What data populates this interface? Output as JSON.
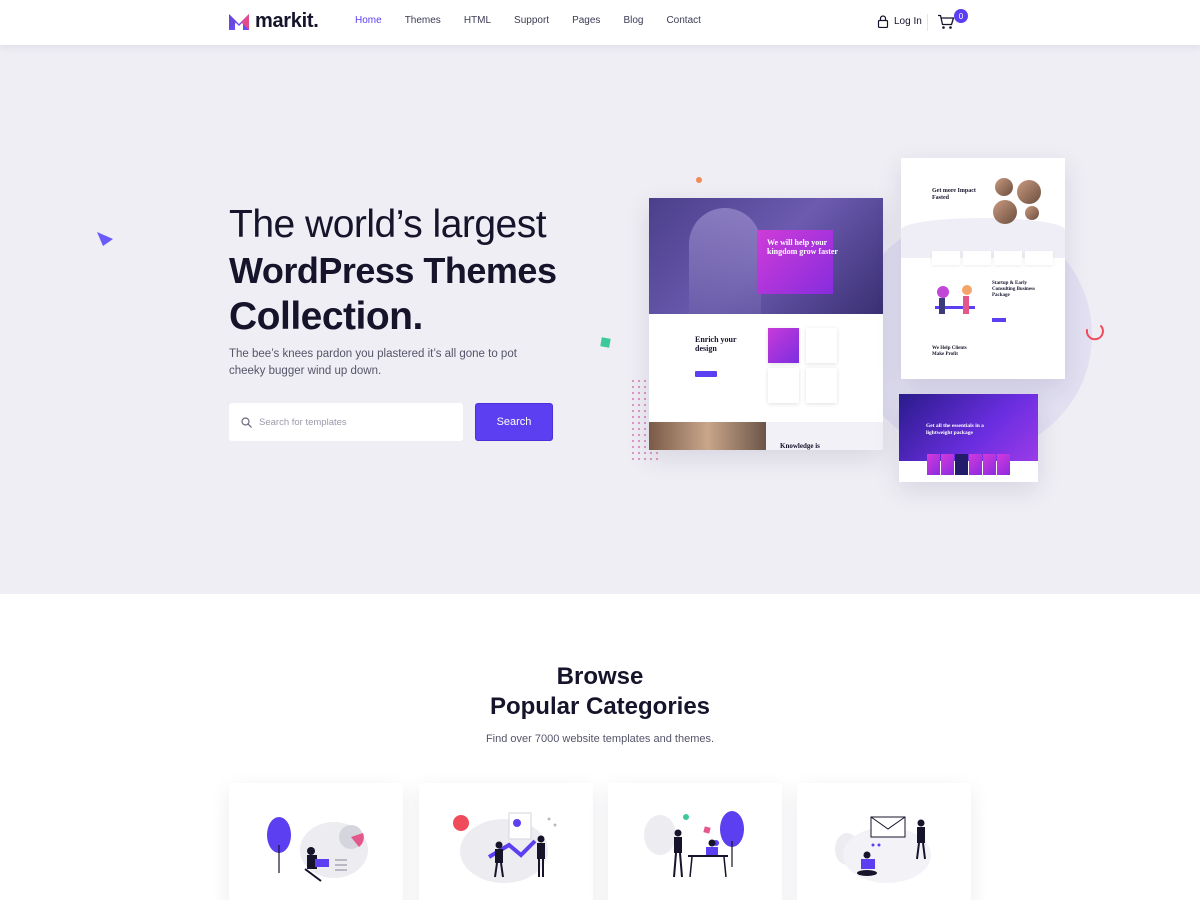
{
  "header": {
    "logo_text": "markit.",
    "nav": [
      {
        "label": "Home",
        "active": true
      },
      {
        "label": "Themes",
        "active": false
      },
      {
        "label": "HTML",
        "active": false
      },
      {
        "label": "Support",
        "active": false
      },
      {
        "label": "Pages",
        "active": false
      },
      {
        "label": "Blog",
        "active": false
      },
      {
        "label": "Contact",
        "active": false
      }
    ],
    "login_label": "Log In",
    "cart_count": "0"
  },
  "hero": {
    "title_line1": "The world’s largest",
    "title_line2": "WordPress Themes",
    "title_line3": "Collection.",
    "subtitle": "The bee’s knees pardon you plastered it’s all gone to pot cheeky bugger wind up down.",
    "search_placeholder": "Search for templates",
    "search_button": "Search"
  },
  "mockups": {
    "a_hero_text": "We will help your kingdom grow faster",
    "a_section_title": "Enrich your design",
    "a_bottom_title": "Knowledge is",
    "b_title": "Get more Impact Fasted",
    "b_section_title": "Startup & Early Consulting Business Package",
    "b_footer_title": "We Help Clients Make Profit",
    "c_title": "Get all the essentials in a lightweight package"
  },
  "browse": {
    "title_line1": "Browse",
    "title_line2": "Popular Categories",
    "subtitle": "Find over 7000 website templates and themes."
  },
  "colors": {
    "accent": "#5b3ff0",
    "hero_bg": "#efeef4",
    "dark_text": "#15142b"
  }
}
